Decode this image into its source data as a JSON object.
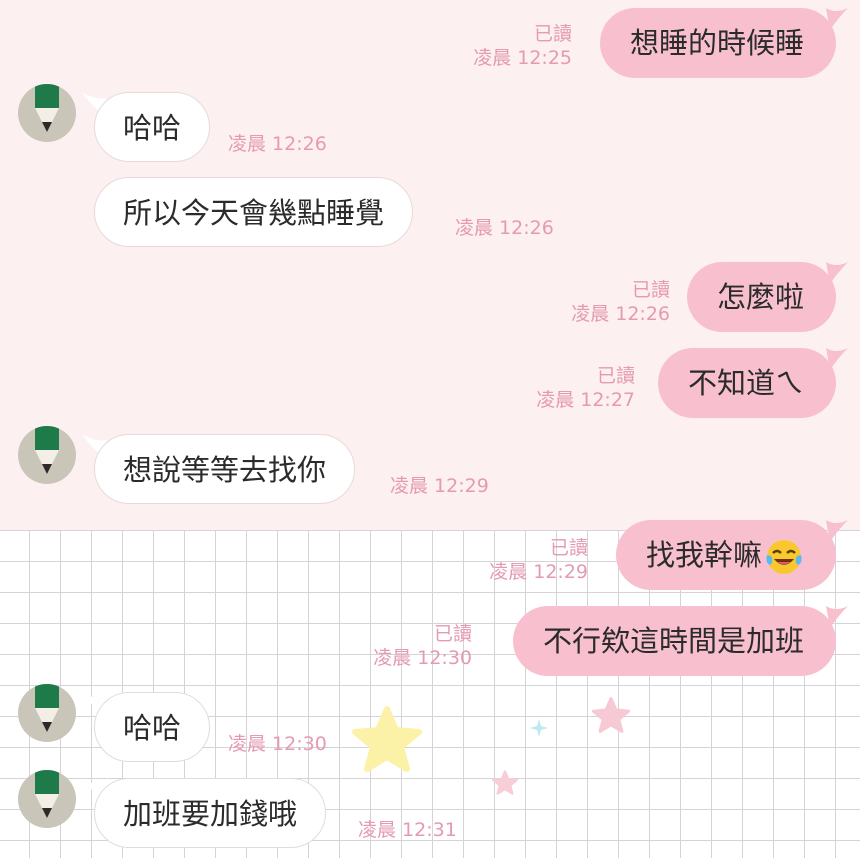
{
  "chat": {
    "messages": [
      {
        "side": "out",
        "text": "想睡的時候睡",
        "read": "已讀",
        "time": "凌晨 12:25"
      },
      {
        "side": "in",
        "text": "哈哈",
        "time": "凌晨 12:26"
      },
      {
        "side": "in",
        "text": "所以今天會幾點睡覺",
        "time": "凌晨 12:26"
      },
      {
        "side": "out",
        "text": "怎麼啦",
        "read": "已讀",
        "time": "凌晨 12:26"
      },
      {
        "side": "out",
        "text": "不知道ㄟ",
        "read": "已讀",
        "time": "凌晨 12:27"
      },
      {
        "side": "in",
        "text": "想說等等去找你",
        "time": "凌晨 12:29"
      },
      {
        "side": "out",
        "text": "找我幹嘛",
        "emoji": "laughing-tears-emoji",
        "read": "已讀",
        "time": "凌晨 12:29"
      },
      {
        "side": "out",
        "text": "不行欸這時間是加班",
        "read": "已讀",
        "time": "凌晨 12:30"
      },
      {
        "side": "in",
        "text": "哈哈",
        "time": "凌晨 12:30"
      },
      {
        "side": "in",
        "text": "加班要加錢哦",
        "time": "凌晨 12:31"
      }
    ]
  },
  "colors": {
    "outgoing_bubble": "#f8c0cf",
    "incoming_bubble": "#ffffff",
    "meta_text": "#e59ab0",
    "background_top": "#fdf0f1",
    "avatar_green": "#1f7a4a"
  }
}
